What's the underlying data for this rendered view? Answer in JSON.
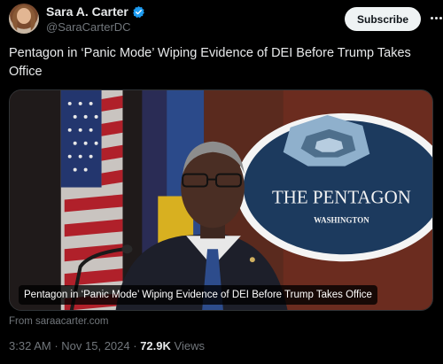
{
  "author": {
    "display_name": "Sara A. Carter",
    "handle": "@SaraCarterDC",
    "verified": true
  },
  "actions": {
    "subscribe_label": "Subscribe"
  },
  "tweet": {
    "text": "Pentagon in ‘Panic Mode’ Wiping Evidence of DEI Before Trump Takes Office"
  },
  "card": {
    "caption": "Pentagon in ‘Panic Mode’ Wiping Evidence of DEI Before Trump Takes Office",
    "image_text": {
      "seal_title": "THE PENTAGON",
      "seal_subtitle": "WASHINGTON"
    },
    "source": "From saraacarter.com"
  },
  "meta": {
    "time": "3:32 AM",
    "date": "Nov 15, 2024",
    "views_count": "72.9K",
    "views_label": "Views"
  },
  "colors": {
    "background": "#000000",
    "text": "#e7e9ea",
    "secondary": "#71767b",
    "verified": "#1d9bf0"
  }
}
